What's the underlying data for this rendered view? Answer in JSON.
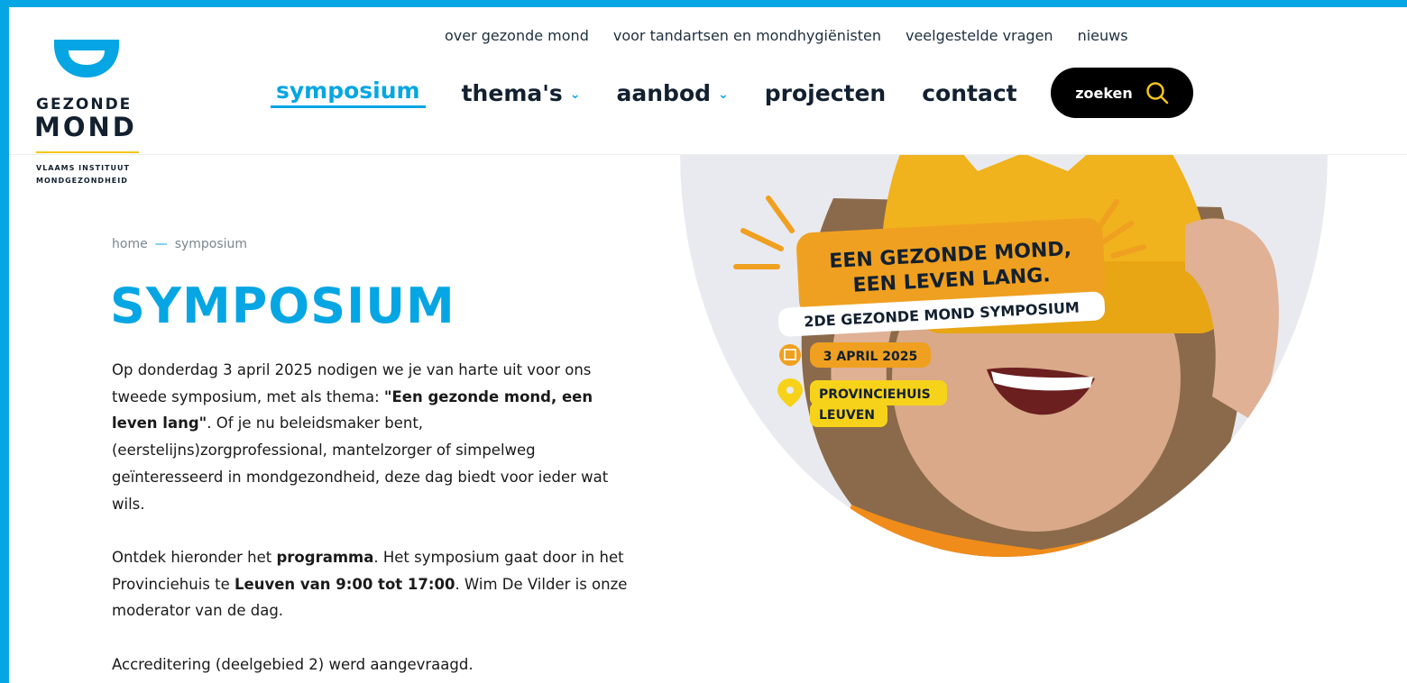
{
  "logo": {
    "word1": "GEZONDE",
    "word2": "MOND",
    "sub1": "VLAAMS INSTITUUT",
    "sub2": "MONDGEZONDHEID"
  },
  "top_nav": [
    "over gezonde mond",
    "voor tandartsen en mondhygiënisten",
    "veelgestelde vragen",
    "nieuws"
  ],
  "main_nav": {
    "symposium": "symposium",
    "themas": "thema's",
    "aanbod": "aanbod",
    "projecten": "projecten",
    "contact": "contact"
  },
  "search": {
    "label": "zoeken"
  },
  "breadcrumb": {
    "home": "home",
    "sep": "—",
    "current": "symposium"
  },
  "page_title": "SYMPOSIUM",
  "content": {
    "p1_a": "Op donderdag 3 april 2025 nodigen we je van harte uit voor ons tweede symposium, met als thema: ",
    "p1_b": "\"Een gezonde mond, een leven lang\"",
    "p1_c": ". Of je nu beleidsmaker bent, (eerstelijns)zorgprofessional, mantelzorger of simpelweg geïnteresseerd in mondgezondheid, deze dag biedt voor ieder wat wils.",
    "p2_a": "Ontdek hieronder het ",
    "p2_b": "programma",
    "p2_c": ". Het symposium gaat door in het Provinciehuis te ",
    "p2_d": "Leuven van 9:00 tot 17:00",
    "p2_e": ". Wim De Vilder is onze moderator van de dag.",
    "p3": "Accreditering (deelgebied 2) werd aangevraagd."
  },
  "hero": {
    "headline1": "EEN GEZONDE MOND,",
    "headline2": "EEN LEVEN LANG.",
    "subtitle": "2DE GEZONDE MOND SYMPOSIUM",
    "date": "3 APRIL 2025",
    "location1": "PROVINCIEHUIS",
    "location2": "LEUVEN"
  },
  "colors": {
    "brand_blue": "#05a6e3",
    "dark": "#12202f",
    "yellow": "#f5c518",
    "orange": "#f0a020"
  }
}
